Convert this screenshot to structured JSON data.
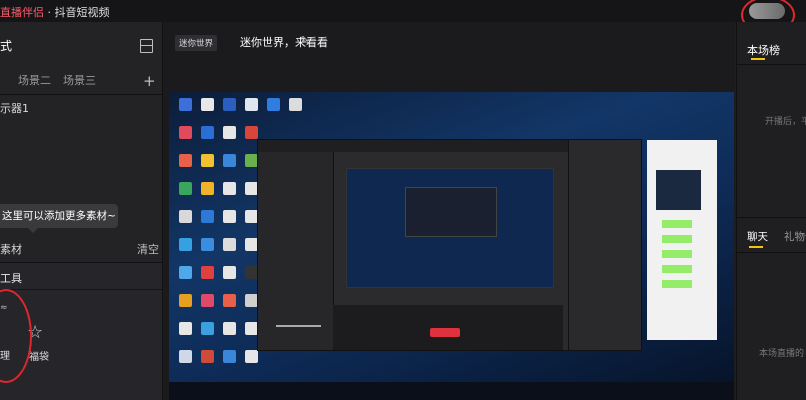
{
  "window": {
    "title_accent": "直播伴侣",
    "title_rest": " · 抖音短视频"
  },
  "left_panel": {
    "scene_header": "式",
    "tabs": [
      "",
      "场景二",
      "场景三"
    ],
    "add_tab_glyph": "+",
    "source_item": "示器1",
    "tooltip": "这里可以添加更多素材~",
    "material_label": "素材",
    "clear_label": "清空",
    "tools_label": "工具",
    "small_mark": "≈",
    "manage_label": "理",
    "bag_label": "福袋"
  },
  "center": {
    "badge": "迷你世界",
    "title": "迷你世界，来看看",
    "edit_glyph": "✎"
  },
  "right_panel": {
    "tab_rank": "本场榜",
    "rank_empty": "开播后，平",
    "tab_chat": "聊天",
    "tab_gift": "礼物信",
    "chat_empty": "本场直播的"
  },
  "colors": {
    "accent_red": "#e0262e",
    "tab_indicator": "#f1c40f",
    "title_accent": "#ff5b6b"
  }
}
